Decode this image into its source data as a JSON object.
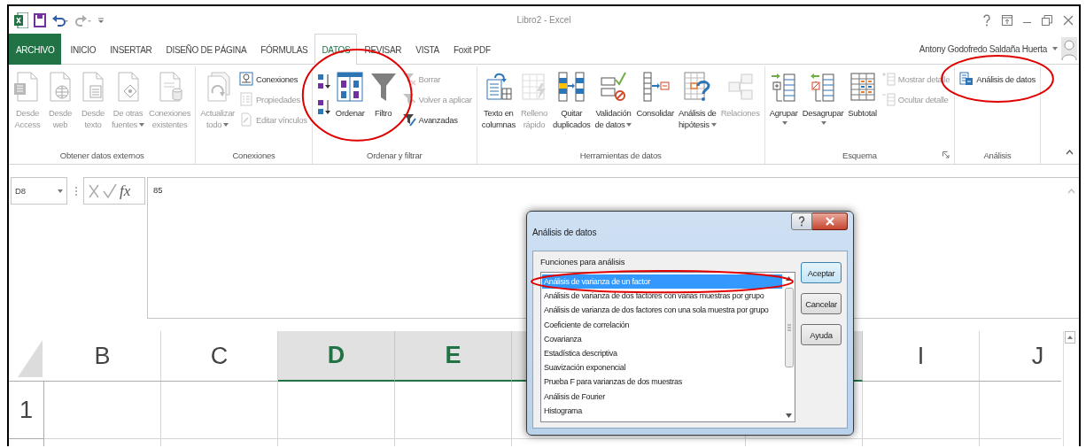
{
  "window": {
    "title": "Libro2 - Excel"
  },
  "tabs": [
    {
      "label": "ARCHIVO",
      "kind": "file",
      "selected": false
    },
    {
      "label": "INICIO",
      "kind": "tab",
      "selected": false
    },
    {
      "label": "INSERTAR",
      "kind": "tab",
      "selected": false
    },
    {
      "label": "DISEÑO DE PÁGINA",
      "kind": "tab",
      "selected": false
    },
    {
      "label": "FÓRMULAS",
      "kind": "tab",
      "selected": false
    },
    {
      "label": "DATOS",
      "kind": "tab",
      "selected": true
    },
    {
      "label": "REVISAR",
      "kind": "tab",
      "selected": false
    },
    {
      "label": "VISTA",
      "kind": "tab",
      "selected": false
    },
    {
      "label": "Foxit PDF",
      "kind": "tab",
      "selected": false
    }
  ],
  "account": {
    "name": "Antony Godofredo Saldaña Huerta"
  },
  "ribbon": {
    "groups": [
      {
        "label": "Obtener datos externos",
        "launcher": false,
        "items": [
          {
            "kind": "large",
            "label": "Desde\nAccess",
            "disabled": true
          },
          {
            "kind": "large",
            "label": "Desde\nweb",
            "disabled": true
          },
          {
            "kind": "large",
            "label": "Desde\ntexto",
            "disabled": true
          },
          {
            "kind": "large",
            "label": "De otras\nfuentes",
            "menu": true,
            "disabled": true
          },
          {
            "kind": "large",
            "label": "Conexiones\nexistentes",
            "disabled": true
          }
        ]
      },
      {
        "label": "Conexiones",
        "launcher": false,
        "items": [
          {
            "kind": "large",
            "label": "Actualizar\ntodo",
            "menu": true,
            "disabled": true
          },
          {
            "kind": "stack",
            "items": [
              {
                "kind": "small",
                "label": "Conexiones",
                "disabled": false
              },
              {
                "kind": "small",
                "label": "Propiedades",
                "disabled": true
              },
              {
                "kind": "small",
                "label": "Editar vínculos",
                "disabled": true
              }
            ]
          }
        ]
      },
      {
        "label": "Ordenar y filtrar",
        "launcher": false,
        "items": [
          {
            "kind": "stack",
            "items": [
              {
                "kind": "icon",
                "disabled": false
              },
              {
                "kind": "icon",
                "disabled": false
              }
            ]
          },
          {
            "kind": "large",
            "label": "Ordenar",
            "disabled": false
          },
          {
            "kind": "large",
            "label": "Filtro",
            "disabled": false
          },
          {
            "kind": "stack",
            "items": [
              {
                "kind": "small",
                "label": "Borrar",
                "disabled": true
              },
              {
                "kind": "small",
                "label": "Volver a aplicar",
                "disabled": true
              },
              {
                "kind": "small",
                "label": "Avanzadas",
                "disabled": false
              }
            ]
          }
        ]
      },
      {
        "label": "Herramientas de datos",
        "launcher": false,
        "items": [
          {
            "kind": "large",
            "label": "Texto en\ncolumnas",
            "disabled": false
          },
          {
            "kind": "large",
            "label": "Relleno\nrápido",
            "disabled": true
          },
          {
            "kind": "large",
            "label": "Quitar\nduplicados",
            "disabled": false
          },
          {
            "kind": "large",
            "label": "Validación\nde datos",
            "menu": true,
            "disabled": false
          },
          {
            "kind": "large",
            "label": "Consolidar",
            "disabled": false
          },
          {
            "kind": "large",
            "label": "Análisis de\nhipótesis",
            "menu": true,
            "disabled": false
          },
          {
            "kind": "large",
            "label": "Relaciones",
            "disabled": true
          }
        ]
      },
      {
        "label": "Esquema",
        "launcher": true,
        "items": [
          {
            "kind": "large",
            "label": "Agrupar",
            "menu": true,
            "disabled": false
          },
          {
            "kind": "large",
            "label": "Desagrupar",
            "menu": true,
            "disabled": false
          },
          {
            "kind": "large",
            "label": "Subtotal",
            "disabled": false
          },
          {
            "kind": "stack",
            "items": [
              {
                "kind": "small",
                "label": "Mostrar detalle",
                "disabled": true
              },
              {
                "kind": "small",
                "label": "Ocultar detalle",
                "disabled": true
              }
            ]
          }
        ]
      },
      {
        "label": "Análisis",
        "launcher": false,
        "items": [
          {
            "kind": "stack",
            "items": [
              {
                "kind": "small",
                "label": "Análisis de datos",
                "disabled": false
              }
            ]
          }
        ]
      }
    ]
  },
  "formula_bar": {
    "name_box": "D8",
    "function_label": "fx",
    "value": "85"
  },
  "sheet": {
    "columns": [
      {
        "label": "B",
        "selected": false
      },
      {
        "label": "C",
        "selected": false
      },
      {
        "label": "D",
        "selected": true
      },
      {
        "label": "E",
        "selected": true
      },
      {
        "selected": true
      },
      {
        "selected": true
      },
      {
        "label": "I",
        "selected": false
      },
      {
        "label": "J",
        "selected": false
      }
    ],
    "rows": [
      {
        "label": "1"
      }
    ]
  },
  "dialog": {
    "title": "Análisis de datos",
    "list_label": "Funciones para análisis",
    "items": [
      {
        "label": "Análisis de varianza de un factor",
        "selected": true
      },
      {
        "label": "Análisis de varianza de dos factores con varias muestras por grupo",
        "selected": false
      },
      {
        "label": "Análisis de varianza de dos factores con una sola muestra por grupo",
        "selected": false
      },
      {
        "label": "Coeficiente de correlación",
        "selected": false
      },
      {
        "label": "Covarianza",
        "selected": false
      },
      {
        "label": "Estadística descriptiva",
        "selected": false
      },
      {
        "label": "Suavización exponencial",
        "selected": false
      },
      {
        "label": "Prueba F para varianzas de dos muestras",
        "selected": false
      },
      {
        "label": "Análisis de Fourier",
        "selected": false
      },
      {
        "label": "Histograma",
        "selected": false
      }
    ],
    "buttons": [
      {
        "label": "Aceptar",
        "default": true
      },
      {
        "label": "Cancelar",
        "default": false
      },
      {
        "label": "Ayuda",
        "default": false
      }
    ]
  }
}
